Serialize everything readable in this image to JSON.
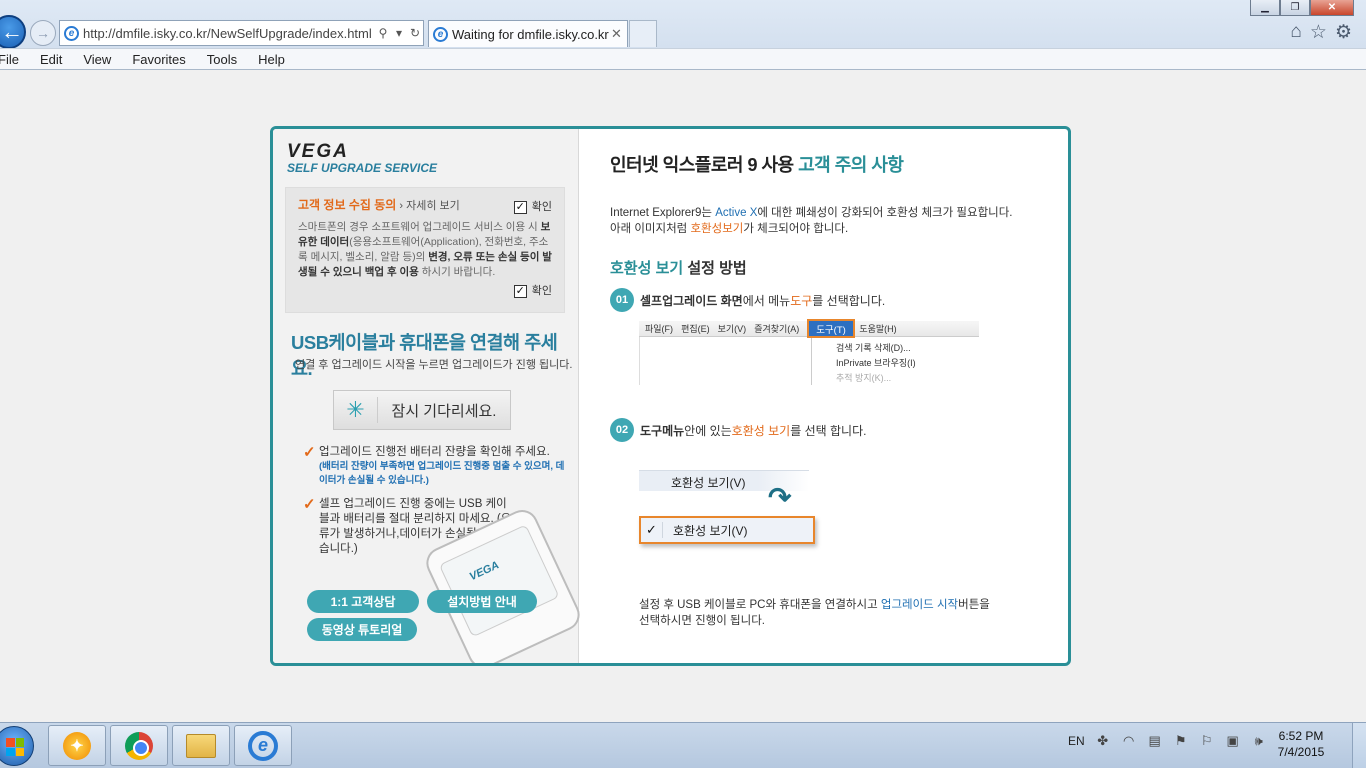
{
  "browser": {
    "url": "http://dmfile.isky.co.kr/NewSelfUpgrade/index.html",
    "tab_title": "Waiting for dmfile.isky.co.kr",
    "menu": [
      "File",
      "Edit",
      "View",
      "Favorites",
      "Tools",
      "Help"
    ]
  },
  "left": {
    "logo_brand": "VEGA",
    "logo_service": "SELF UPGRADE SERVICE",
    "consent": {
      "title": "고객 정보 수집 동의",
      "more": " › 자세히 보기",
      "check_label": "확인",
      "desc_1": "스마트폰의 경우 소프트웨어 업그레이드 서비스 이용 시 ",
      "desc_bold_1": "보유한 데이터",
      "desc_2": "(응용소프트웨어(Application), 전화번호, 주소록 메시지, 벨소리, 알람 등)의 ",
      "desc_bold_2": "변경, 오류 또는 손실 등이 발생될 수 있으니 백업 후 이용",
      "desc_3": " 하시기 바랍니다.",
      "check_label_2": "확인"
    },
    "usb_title": "USB케이블과 휴대폰을 연결해 주세요.",
    "usb_subtitle": "연결 후 업그레이드 시작을 누르면 업그레이드가 진행 됩니다.",
    "wait_button": "잠시 기다리세요.",
    "note1": "업그레이드 진행전 배터리 잔량을 확인해 주세요.",
    "note1_warn": "(배터리 잔량이 부족하면 업그레이드 진행중 멈출 수 있으며, 데이터가 손실될 수 있습니다.)",
    "note2": "셀프 업그레이드 진행 중에는 USB 케이블과 배터리를 절대 분리하지 마세요. (오류가 발생하거나,데이터가 손실될 수 있습니다.)",
    "phone_brand": "VEGA",
    "buttons": {
      "consult": "1:1 고객상담",
      "install_guide": "설치방법 안내",
      "video_tutorial": "동영상 튜토리얼"
    }
  },
  "right": {
    "title_1": "인터넷 익스플로러 9 사용 ",
    "title_2": "고객 주의 사항",
    "intro_a": "Internet Explorer9는 ",
    "intro_activex": "Active X",
    "intro_b": "에 대한 폐쇄성이 강화되어 호환성 체크가 필요합니다.",
    "intro_c": "아래 이미지처럼 ",
    "intro_compat": "호환성보기",
    "intro_d": "가 체크되어야 합니다.",
    "method_1": "호환성 보기",
    "method_2": " 설정 방법",
    "step1_num": "01",
    "step1_bold": "셀프업그레이드 화면",
    "step1_a": "에서 메뉴 ",
    "step1_tool": "도구",
    "step1_b": "를 선택합니다.",
    "step2_num": "02",
    "step2_bold": "도구메뉴",
    "step2_a": " 안에 있는 ",
    "step2_compat": "호환성 보기",
    "step2_b": "를 선택 합니다.",
    "shot_menu": [
      "파일(F)",
      "편집(E)",
      "보기(V)",
      "즐겨찾기(A)"
    ],
    "shot_tools": "도구(T)",
    "shot_help": "도움말(H)",
    "shot_drop": [
      "검색 기록 삭제(D)...",
      "InPrivate 브라우징(I)",
      "추적 방지(K)..."
    ],
    "compat_label_1": "호환성 보기(V)",
    "compat_check": "✓",
    "compat_label_2": "호환성 보기(V)",
    "final_a": "설정 후 USB 케이블로 PC와 휴대폰을 연결하시고 ",
    "final_upgrade": "업그레이드 시작",
    "final_b": "버튼을",
    "final_c": "선택하시면 진행이 됩니다."
  },
  "taskbar": {
    "lang": "EN",
    "time": "6:52 PM",
    "date": "7/4/2015"
  }
}
